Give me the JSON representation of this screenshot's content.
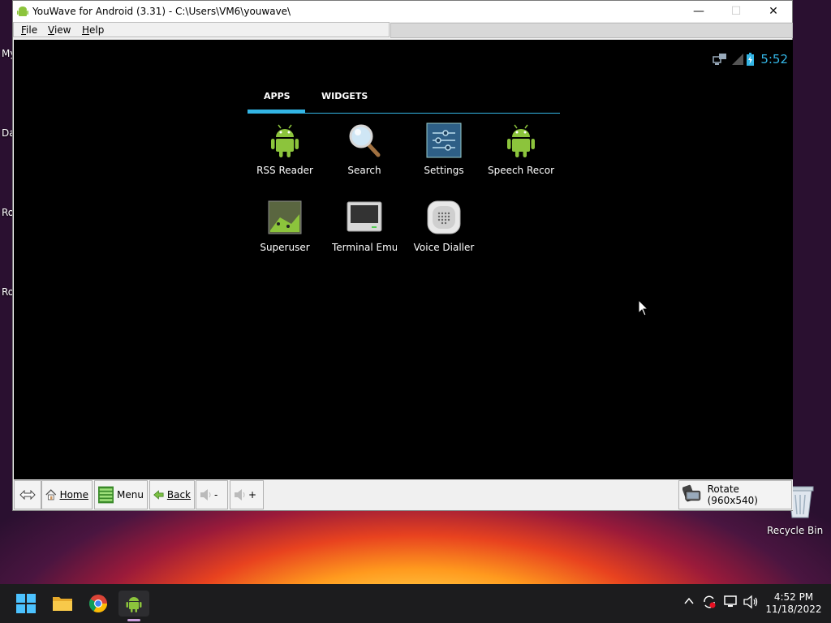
{
  "window": {
    "title": "YouWave for Android (3.31) - C:\\Users\\VM6\\youwave\\",
    "minimize": "—",
    "maximize": "☐",
    "close": "✕"
  },
  "menu": {
    "file": "File",
    "view": "View",
    "help": "Help"
  },
  "desktop": {
    "labels": [
      "My",
      "Da",
      "Ro",
      "Ro"
    ],
    "recycle_bin": "Recycle Bin"
  },
  "android": {
    "clock": "5:52",
    "tabs": {
      "apps": "APPS",
      "widgets": "WIDGETS"
    },
    "apps": [
      {
        "label": "RSS Reader",
        "icon": "android-robot-icon"
      },
      {
        "label": "Search",
        "icon": "magnifier-icon"
      },
      {
        "label": "Settings",
        "icon": "settings-sliders-icon"
      },
      {
        "label": "Speech Recor",
        "icon": "android-robot-icon"
      },
      {
        "label": "Superuser",
        "icon": "superuser-icon"
      },
      {
        "label": "Terminal Emu",
        "icon": "terminal-icon"
      },
      {
        "label": "Voice Dialler",
        "icon": "voice-dialler-icon"
      }
    ],
    "accent_color": "#33b5e5"
  },
  "toolbar": {
    "home": "Home",
    "menu": "Menu",
    "back": "Back",
    "vol_down": "-",
    "vol_up": "+",
    "rotate": "Rotate (960x540)"
  },
  "taskbar": {
    "time": "4:52 PM",
    "date": "11/18/2022"
  }
}
